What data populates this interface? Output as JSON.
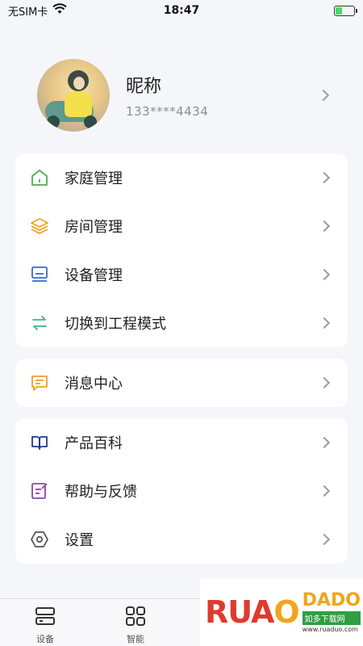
{
  "status": {
    "carrier": "无SIM卡",
    "time": "18:47",
    "battery_level": 0.35
  },
  "profile": {
    "nickname": "昵称",
    "phone": "133****4434"
  },
  "menu_group_1": [
    {
      "label": "家庭管理",
      "icon": "home-icon",
      "color": "#4caf50"
    },
    {
      "label": "房间管理",
      "icon": "layers-icon",
      "color": "#f0a020"
    },
    {
      "label": "设备管理",
      "icon": "device-icon",
      "color": "#2b6fd6"
    },
    {
      "label": "切换到工程模式",
      "icon": "switch-icon",
      "color": "#38b48b"
    }
  ],
  "menu_group_2": [
    {
      "label": "消息中心",
      "icon": "message-icon",
      "color": "#f0a020"
    }
  ],
  "menu_group_3": [
    {
      "label": "产品百科",
      "icon": "book-icon",
      "color": "#1f3a8a"
    },
    {
      "label": "帮助与反馈",
      "icon": "feedback-icon",
      "color": "#8e44ad"
    },
    {
      "label": "设置",
      "icon": "settings-icon",
      "color": "#555555"
    }
  ],
  "tabbar": [
    {
      "label": "设备",
      "icon": "device-tab-icon"
    },
    {
      "label": "智能",
      "icon": "grid-tab-icon"
    }
  ],
  "watermark": {
    "logo_left": "RUA",
    "logo_o": "O",
    "logo_right": "DADO",
    "tag": "如多下载网",
    "url": "www.ruaduo.com"
  }
}
